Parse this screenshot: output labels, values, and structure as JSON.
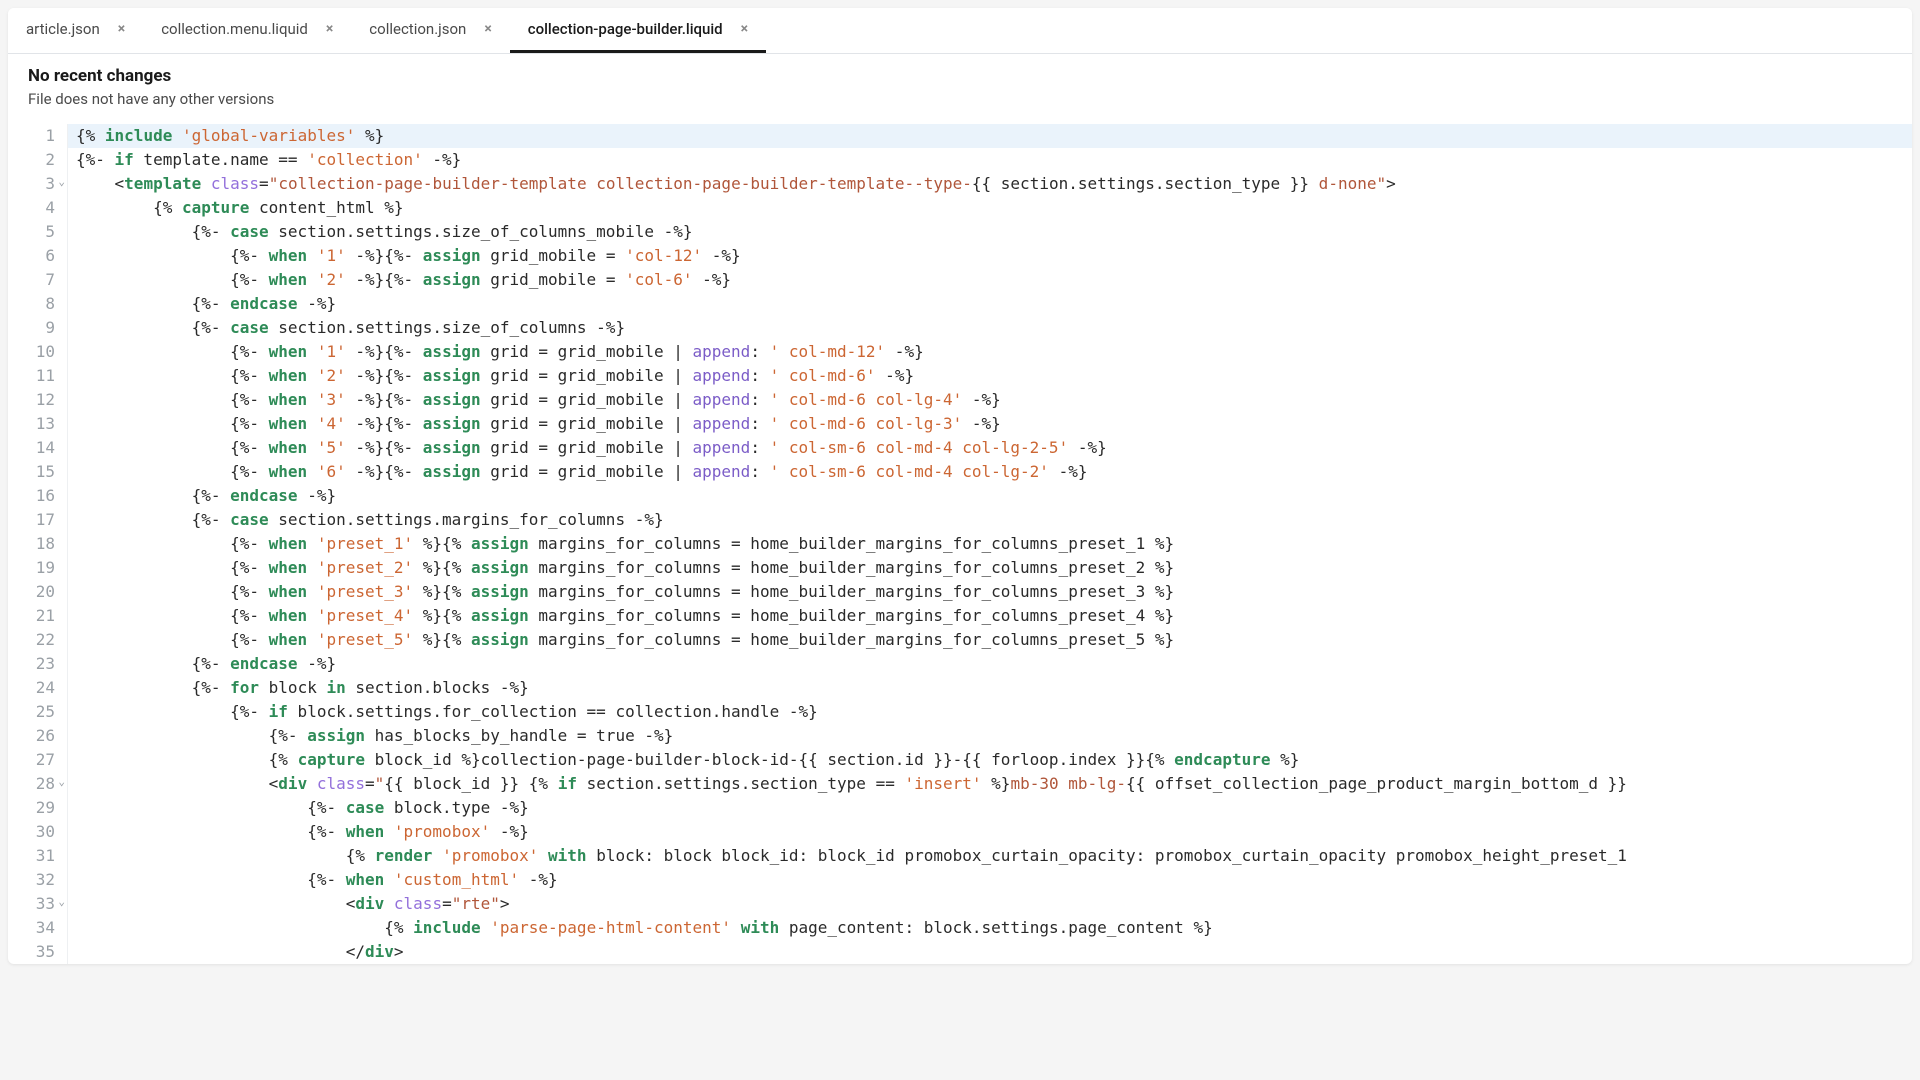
{
  "tabs": [
    {
      "label": "article.json",
      "active": false
    },
    {
      "label": "collection.menu.liquid",
      "active": false
    },
    {
      "label": "collection.json",
      "active": false
    },
    {
      "label": "collection-page-builder.liquid",
      "active": true
    }
  ],
  "info": {
    "title": "No recent changes",
    "subtitle": "File does not have any other versions"
  },
  "code": {
    "lines": [
      {
        "n": 1,
        "hl": true,
        "fold": false,
        "html": "{% <kw>include</kw> <str>'global-variables'</str> %}"
      },
      {
        "n": 2,
        "fold": false,
        "html": "{%- <kw>if</kw> template.name == <str>'collection'</str> -%}"
      },
      {
        "n": 3,
        "fold": true,
        "html": "    &lt;<tag>template</tag> <attr>class</attr>=<cls>\"collection-page-builder-template collection-page-builder-template--type-</cls>{{ section.settings.section_type }}<cls> d-none\"</cls>&gt;"
      },
      {
        "n": 4,
        "fold": false,
        "html": "        {% <kw>capture</kw> content_html %}"
      },
      {
        "n": 5,
        "fold": false,
        "html": "            {%- <kw>case</kw> section.settings.size_of_columns_mobile -%}"
      },
      {
        "n": 6,
        "fold": false,
        "html": "                {%- <kw>when</kw> <str>'1'</str> -%}{%- <kw>assign</kw> grid_mobile = <str>'col-12'</str> -%}"
      },
      {
        "n": 7,
        "fold": false,
        "html": "                {%- <kw>when</kw> <str>'2'</str> -%}{%- <kw>assign</kw> grid_mobile = <str>'col-6'</str> -%}"
      },
      {
        "n": 8,
        "fold": false,
        "html": "            {%- <kw>endcase</kw> -%}"
      },
      {
        "n": 9,
        "fold": false,
        "html": "            {%- <kw>case</kw> section.settings.size_of_columns -%}"
      },
      {
        "n": 10,
        "fold": false,
        "html": "                {%- <kw>when</kw> <str>'1'</str> -%}{%- <kw>assign</kw> grid = grid_mobile | <fn>append</fn>: <str>' col-md-12'</str> -%}"
      },
      {
        "n": 11,
        "fold": false,
        "html": "                {%- <kw>when</kw> <str>'2'</str> -%}{%- <kw>assign</kw> grid = grid_mobile | <fn>append</fn>: <str>' col-md-6'</str> -%}"
      },
      {
        "n": 12,
        "fold": false,
        "html": "                {%- <kw>when</kw> <str>'3'</str> -%}{%- <kw>assign</kw> grid = grid_mobile | <fn>append</fn>: <str>' col-md-6 col-lg-4'</str> -%}"
      },
      {
        "n": 13,
        "fold": false,
        "html": "                {%- <kw>when</kw> <str>'4'</str> -%}{%- <kw>assign</kw> grid = grid_mobile | <fn>append</fn>: <str>' col-md-6 col-lg-3'</str> -%}"
      },
      {
        "n": 14,
        "fold": false,
        "html": "                {%- <kw>when</kw> <str>'5'</str> -%}{%- <kw>assign</kw> grid = grid_mobile | <fn>append</fn>: <str>' col-sm-6 col-md-4 col-lg-2-5'</str> -%}"
      },
      {
        "n": 15,
        "fold": false,
        "html": "                {%- <kw>when</kw> <str>'6'</str> -%}{%- <kw>assign</kw> grid = grid_mobile | <fn>append</fn>: <str>' col-sm-6 col-md-4 col-lg-2'</str> -%}"
      },
      {
        "n": 16,
        "fold": false,
        "html": "            {%- <kw>endcase</kw> -%}"
      },
      {
        "n": 17,
        "fold": false,
        "html": "            {%- <kw>case</kw> section.settings.margins_for_columns -%}"
      },
      {
        "n": 18,
        "fold": false,
        "html": "                {%- <kw>when</kw> <str>'preset_1'</str> %}{% <kw>assign</kw> margins_for_columns = home_builder_margins_for_columns_preset_1 %}"
      },
      {
        "n": 19,
        "fold": false,
        "html": "                {%- <kw>when</kw> <str>'preset_2'</str> %}{% <kw>assign</kw> margins_for_columns = home_builder_margins_for_columns_preset_2 %}"
      },
      {
        "n": 20,
        "fold": false,
        "html": "                {%- <kw>when</kw> <str>'preset_3'</str> %}{% <kw>assign</kw> margins_for_columns = home_builder_margins_for_columns_preset_3 %}"
      },
      {
        "n": 21,
        "fold": false,
        "html": "                {%- <kw>when</kw> <str>'preset_4'</str> %}{% <kw>assign</kw> margins_for_columns = home_builder_margins_for_columns_preset_4 %}"
      },
      {
        "n": 22,
        "fold": false,
        "html": "                {%- <kw>when</kw> <str>'preset_5'</str> %}{% <kw>assign</kw> margins_for_columns = home_builder_margins_for_columns_preset_5 %}"
      },
      {
        "n": 23,
        "fold": false,
        "html": "            {%- <kw>endcase</kw> -%}"
      },
      {
        "n": 24,
        "fold": false,
        "html": "            {%- <kw>for</kw> block <kw>in</kw> section.blocks -%}"
      },
      {
        "n": 25,
        "fold": false,
        "html": "                {%- <kw>if</kw> block.settings.for_collection == collection.handle -%}"
      },
      {
        "n": 26,
        "fold": false,
        "html": "                    {%- <kw>assign</kw> has_blocks_by_handle = true -%}"
      },
      {
        "n": 27,
        "fold": false,
        "html": "                    {% <kw>capture</kw> block_id %}collection-page-builder-block-id-{{ section.id }}-{{ forloop.index }}{% <kw>endcapture</kw> %}"
      },
      {
        "n": 28,
        "fold": true,
        "html": "                    &lt;<tag>div</tag> <attr>class</attr>=<cls>\"</cls>{{ block_id }} {% <kw>if</kw> section.settings.section_type == <str>'insert'</str> %}<cls>mb-30 mb-lg-</cls>{{ offset_collection_page_product_margin_bottom_d }}"
      },
      {
        "n": 29,
        "fold": false,
        "html": "                        {%- <kw>case</kw> block.type -%}"
      },
      {
        "n": 30,
        "fold": false,
        "html": "                        {%- <kw>when</kw> <str>'promobox'</str> -%}"
      },
      {
        "n": 31,
        "fold": false,
        "html": "                            {% <kw>render</kw> <str>'promobox'</str> <kw>with</kw> block: block block_id: block_id promobox_curtain_opacity: promobox_curtain_opacity promobox_height_preset_1"
      },
      {
        "n": 32,
        "fold": false,
        "html": "                        {%- <kw>when</kw> <str>'custom_html'</str> -%}"
      },
      {
        "n": 33,
        "fold": true,
        "html": "                            &lt;<tag>div</tag> <attr>class</attr>=<cls>\"rte\"</cls>&gt;"
      },
      {
        "n": 34,
        "fold": false,
        "html": "                                {% <kw>include</kw> <str>'parse-page-html-content'</str> <kw>with</kw> page_content: block.settings.page_content %}"
      },
      {
        "n": 35,
        "fold": false,
        "html": "                            &lt;/<tag>div</tag>&gt;"
      }
    ]
  }
}
